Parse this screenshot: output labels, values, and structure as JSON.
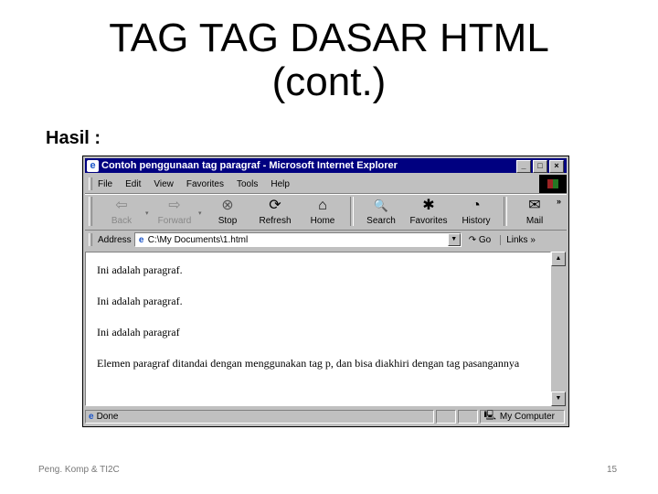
{
  "slide": {
    "title_line1": "TAG TAG DASAR HTML",
    "title_line2": "(cont.)",
    "subtitle": "Hasil :",
    "footer_left": "Peng. Komp & TI2C",
    "page_number": "15"
  },
  "browser": {
    "window_title": "Contoh penggunaan tag paragraf - Microsoft Internet Explorer",
    "window_buttons": [
      "_",
      "□",
      "×"
    ],
    "menu": [
      "File",
      "Edit",
      "View",
      "Favorites",
      "Tools",
      "Help"
    ],
    "toolbar": [
      {
        "label": "Back",
        "icon": "arrow-left-icon",
        "glyph": "⇦"
      },
      {
        "label": "Forward",
        "icon": "arrow-right-icon",
        "glyph": "⇨"
      },
      {
        "label": "Stop",
        "icon": "stop-icon",
        "glyph": "⊗"
      },
      {
        "label": "Refresh",
        "icon": "refresh-icon",
        "glyph": "⟳"
      },
      {
        "label": "Home",
        "icon": "home-icon",
        "glyph": "⌂"
      },
      {
        "label": "Search",
        "icon": "search-icon",
        "glyph": "🔍"
      },
      {
        "label": "Favorites",
        "icon": "favorites-icon",
        "glyph": "✱"
      },
      {
        "label": "History",
        "icon": "history-icon",
        "glyph": "◔"
      },
      {
        "label": "Mail",
        "icon": "mail-icon",
        "glyph": "✉"
      }
    ],
    "toolbar_more": "»",
    "address_label": "Address",
    "address_value": "C:\\My Documents\\1.html",
    "go_label": "Go",
    "links_label": "Links »",
    "content_paragraphs": [
      "Ini adalah paragraf.",
      "Ini adalah paragraf.",
      "Ini adalah paragraf",
      "Elemen paragraf ditandai dengan menggunakan tag p, dan bisa diakhiri dengan tag pasangannya"
    ],
    "status_text": "Done",
    "zone_text": "My Computer"
  }
}
